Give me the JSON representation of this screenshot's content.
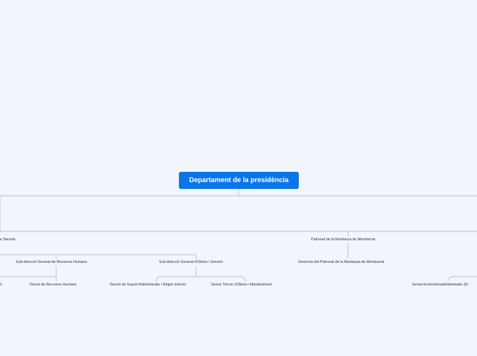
{
  "root": {
    "label": "Departament de la presidència"
  },
  "nodes": {
    "serveis_partial": "e Serveis",
    "rrhh": "Sub-direcció General de Recursos Humans",
    "obres": "Sub-direcció General d'Obres i Serveis",
    "patronat": "Patronat de la Muntanya de Montserrat",
    "gerencia": "Gerència del Patronat de la Muntanya de Montserrat",
    "partial_left": "ó",
    "servei_rrhh": "Servei de Recursos Humans",
    "seccio_suport": "Secció de Suport Administratiu i Règim Interior",
    "servei_tecnic": "Servei Tècnic d'Obres i Manteniment",
    "servei_econ": "Servei Economicoadministratiu (IC"
  },
  "colors": {
    "background": "#f3f5fd",
    "root_fill": "#0b76e6",
    "root_text": "#ffffff",
    "connector": "#c3c8d6",
    "topic_text": "#2a2f3a"
  }
}
